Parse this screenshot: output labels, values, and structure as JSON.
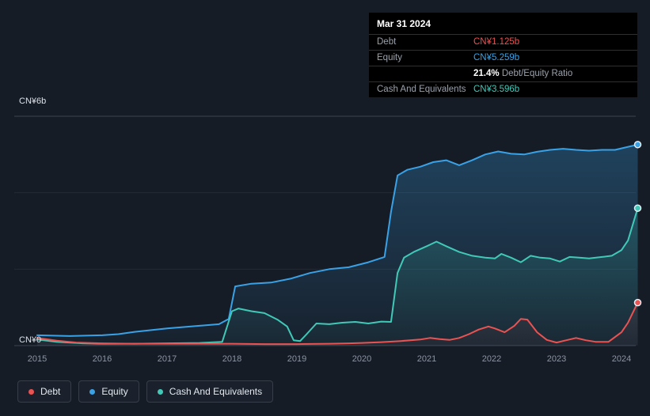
{
  "colors": {
    "debt": "#eb5252",
    "equity": "#39a2e7",
    "cash": "#41c9b8",
    "background": "#161c26",
    "tooltip_bg": "#000000",
    "gridline_major": "#3d4550",
    "gridline_minor": "#232a35"
  },
  "tooltip": {
    "date": "Mar 31 2024",
    "debt_label": "Debt",
    "debt_value": "CN¥1.125b",
    "equity_label": "Equity",
    "equity_value": "CN¥5.259b",
    "ratio_value": "21.4%",
    "ratio_label": "Debt/Equity Ratio",
    "cash_label": "Cash And Equivalents",
    "cash_value": "CN¥3.596b"
  },
  "legend": {
    "items": [
      {
        "label": "Debt",
        "color": "#eb5252"
      },
      {
        "label": "Equity",
        "color": "#39a2e7"
      },
      {
        "label": "Cash And Equivalents",
        "color": "#41c9b8"
      }
    ]
  },
  "chart_data": {
    "type": "area",
    "ylabel_top": "CN¥6b",
    "ylabel_zero": "CN¥0",
    "ylim": [
      0,
      6
    ],
    "y_units": "CN¥ billions",
    "gridline_values": [
      0,
      2,
      4,
      6
    ],
    "legend_position": "bottom-left",
    "x_ticks": [
      "2015",
      "2016",
      "2017",
      "2018",
      "2019",
      "2020",
      "2021",
      "2022",
      "2023",
      "2024"
    ],
    "x_tick_years": [
      2015,
      2016,
      2017,
      2018,
      2019,
      2020,
      2021,
      2022,
      2023,
      2024
    ],
    "series": [
      {
        "name": "Equity",
        "color": "#39a2e7",
        "final_label": "CN¥5.259b",
        "points": [
          [
            2015,
            0.27
          ],
          [
            2015.5,
            0.25
          ],
          [
            2016,
            0.27
          ],
          [
            2016.25,
            0.3
          ],
          [
            2016.5,
            0.36
          ],
          [
            2017,
            0.45
          ],
          [
            2017.5,
            0.52
          ],
          [
            2017.8,
            0.56
          ],
          [
            2017.95,
            0.7
          ],
          [
            2018.05,
            1.55
          ],
          [
            2018.3,
            1.62
          ],
          [
            2018.6,
            1.65
          ],
          [
            2018.9,
            1.75
          ],
          [
            2019.2,
            1.9
          ],
          [
            2019.5,
            2.0
          ],
          [
            2019.8,
            2.05
          ],
          [
            2020.1,
            2.18
          ],
          [
            2020.35,
            2.32
          ],
          [
            2020.45,
            3.5
          ],
          [
            2020.55,
            4.45
          ],
          [
            2020.7,
            4.6
          ],
          [
            2020.9,
            4.68
          ],
          [
            2021.1,
            4.8
          ],
          [
            2021.3,
            4.85
          ],
          [
            2021.5,
            4.72
          ],
          [
            2021.7,
            4.85
          ],
          [
            2021.9,
            5.0
          ],
          [
            2022.1,
            5.08
          ],
          [
            2022.3,
            5.02
          ],
          [
            2022.5,
            5.0
          ],
          [
            2022.7,
            5.07
          ],
          [
            2022.9,
            5.12
          ],
          [
            2023.1,
            5.15
          ],
          [
            2023.3,
            5.12
          ],
          [
            2023.5,
            5.1
          ],
          [
            2023.7,
            5.12
          ],
          [
            2023.9,
            5.12
          ],
          [
            2024.05,
            5.18
          ],
          [
            2024.25,
            5.259
          ]
        ]
      },
      {
        "name": "Cash And Equivalents",
        "color": "#41c9b8",
        "final_label": "CN¥3.596b",
        "points": [
          [
            2015,
            0.16
          ],
          [
            2015.3,
            0.1
          ],
          [
            2015.7,
            0.06
          ],
          [
            2016,
            0.05
          ],
          [
            2016.5,
            0.05
          ],
          [
            2017,
            0.06
          ],
          [
            2017.5,
            0.07
          ],
          [
            2017.85,
            0.1
          ],
          [
            2018,
            0.9
          ],
          [
            2018.1,
            0.97
          ],
          [
            2018.3,
            0.9
          ],
          [
            2018.5,
            0.85
          ],
          [
            2018.7,
            0.68
          ],
          [
            2018.85,
            0.5
          ],
          [
            2018.95,
            0.14
          ],
          [
            2019.05,
            0.12
          ],
          [
            2019.15,
            0.3
          ],
          [
            2019.3,
            0.58
          ],
          [
            2019.5,
            0.56
          ],
          [
            2019.7,
            0.6
          ],
          [
            2019.9,
            0.62
          ],
          [
            2020.1,
            0.58
          ],
          [
            2020.3,
            0.63
          ],
          [
            2020.45,
            0.62
          ],
          [
            2020.55,
            1.9
          ],
          [
            2020.65,
            2.3
          ],
          [
            2020.8,
            2.45
          ],
          [
            2021,
            2.6
          ],
          [
            2021.15,
            2.72
          ],
          [
            2021.3,
            2.6
          ],
          [
            2021.5,
            2.45
          ],
          [
            2021.7,
            2.35
          ],
          [
            2021.9,
            2.3
          ],
          [
            2022.05,
            2.28
          ],
          [
            2022.15,
            2.4
          ],
          [
            2022.3,
            2.3
          ],
          [
            2022.45,
            2.18
          ],
          [
            2022.6,
            2.35
          ],
          [
            2022.75,
            2.3
          ],
          [
            2022.9,
            2.28
          ],
          [
            2023.05,
            2.2
          ],
          [
            2023.2,
            2.32
          ],
          [
            2023.35,
            2.3
          ],
          [
            2023.5,
            2.28
          ],
          [
            2023.7,
            2.32
          ],
          [
            2023.85,
            2.35
          ],
          [
            2024,
            2.5
          ],
          [
            2024.1,
            2.75
          ],
          [
            2024.25,
            3.596
          ]
        ]
      },
      {
        "name": "Debt",
        "color": "#eb5252",
        "final_label": "CN¥1.125b",
        "points": [
          [
            2015,
            0.2
          ],
          [
            2015.3,
            0.13
          ],
          [
            2015.6,
            0.08
          ],
          [
            2016,
            0.06
          ],
          [
            2016.5,
            0.05
          ],
          [
            2017,
            0.05
          ],
          [
            2017.5,
            0.05
          ],
          [
            2018,
            0.05
          ],
          [
            2018.5,
            0.04
          ],
          [
            2019,
            0.04
          ],
          [
            2019.5,
            0.05
          ],
          [
            2019.8,
            0.06
          ],
          [
            2020,
            0.07
          ],
          [
            2020.3,
            0.09
          ],
          [
            2020.6,
            0.12
          ],
          [
            2020.9,
            0.16
          ],
          [
            2021.05,
            0.2
          ],
          [
            2021.2,
            0.17
          ],
          [
            2021.35,
            0.15
          ],
          [
            2021.5,
            0.2
          ],
          [
            2021.65,
            0.3
          ],
          [
            2021.8,
            0.42
          ],
          [
            2021.95,
            0.5
          ],
          [
            2022.05,
            0.45
          ],
          [
            2022.2,
            0.35
          ],
          [
            2022.35,
            0.52
          ],
          [
            2022.45,
            0.7
          ],
          [
            2022.55,
            0.68
          ],
          [
            2022.7,
            0.35
          ],
          [
            2022.85,
            0.15
          ],
          [
            2023,
            0.08
          ],
          [
            2023.15,
            0.14
          ],
          [
            2023.3,
            0.2
          ],
          [
            2023.45,
            0.14
          ],
          [
            2023.6,
            0.1
          ],
          [
            2023.8,
            0.1
          ],
          [
            2024,
            0.35
          ],
          [
            2024.1,
            0.6
          ],
          [
            2024.25,
            1.125
          ]
        ]
      }
    ]
  }
}
